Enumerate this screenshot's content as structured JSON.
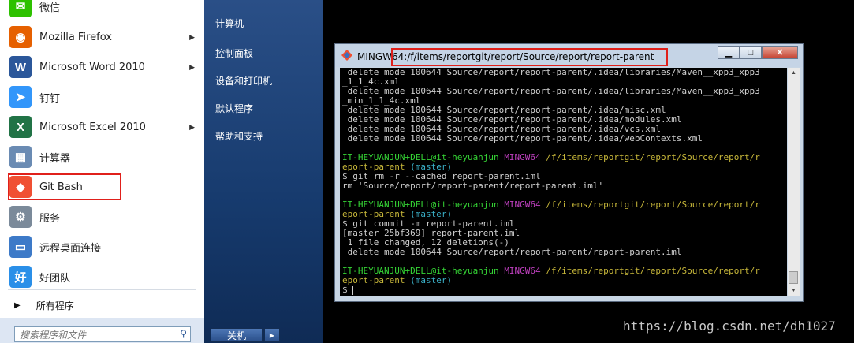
{
  "start_menu": {
    "items": [
      {
        "label": "微信",
        "icon": "wechat-icon",
        "color": "#2dc100",
        "arrow": false
      },
      {
        "label": "Mozilla Firefox",
        "icon": "firefox-icon",
        "color": "#e66000",
        "arrow": true
      },
      {
        "label": "Microsoft Word 2010",
        "icon": "word-icon",
        "color": "#2b579a",
        "arrow": true
      },
      {
        "label": "钉钉",
        "icon": "dingtalk-icon",
        "color": "#3296fa",
        "arrow": false
      },
      {
        "label": "Microsoft Excel 2010",
        "icon": "excel-icon",
        "color": "#217346",
        "arrow": true
      },
      {
        "label": "计算器",
        "icon": "calculator-icon",
        "color": "#6a8bb3",
        "arrow": false
      },
      {
        "label": "Git Bash",
        "icon": "git-bash-icon",
        "color": "#f05033",
        "arrow": false
      },
      {
        "label": "服务",
        "icon": "services-gear-icon",
        "color": "#7b8a9a",
        "arrow": false
      },
      {
        "label": "远程桌面连接",
        "icon": "remote-desktop-icon",
        "color": "#3d7ac8",
        "arrow": false
      },
      {
        "label": "好团队",
        "icon": "haotuandui-icon",
        "color": "#2a8fe8",
        "arrow": false
      }
    ],
    "all_programs": "所有程序",
    "search_placeholder": "搜索程序和文件",
    "right_items": [
      "计算机",
      "控制面板",
      "设备和打印机",
      "默认程序",
      "帮助和支持"
    ],
    "shutdown_label": "关机"
  },
  "terminal": {
    "title": "MINGW64:/f/items/reportgit/report/Source/report/report-parent",
    "lines": [
      [
        {
          "t": " delete mode 100644 Source/report/report-parent/.idea/libraries/Maven__xpp3_xpp3",
          "c": "l-white"
        }
      ],
      [
        {
          "t": "_1_1_4c.xml",
          "c": "l-white"
        }
      ],
      [
        {
          "t": " delete mode 100644 Source/report/report-parent/.idea/libraries/Maven__xpp3_xpp3",
          "c": "l-white"
        }
      ],
      [
        {
          "t": "_min_1_1_4c.xml",
          "c": "l-white"
        }
      ],
      [
        {
          "t": " delete mode 100644 Source/report/report-parent/.idea/misc.xml",
          "c": "l-white"
        }
      ],
      [
        {
          "t": " delete mode 100644 Source/report/report-parent/.idea/modules.xml",
          "c": "l-white"
        }
      ],
      [
        {
          "t": " delete mode 100644 Source/report/report-parent/.idea/vcs.xml",
          "c": "l-white"
        }
      ],
      [
        {
          "t": " delete mode 100644 Source/report/report-parent/.idea/webContexts.xml",
          "c": "l-white"
        }
      ],
      [
        {
          "t": "",
          "c": "l-white"
        }
      ],
      [
        {
          "t": "IT-HEYUANJUN+DELL@it-heyuanjun ",
          "c": "green"
        },
        {
          "t": "MINGW64 ",
          "c": "magenta"
        },
        {
          "t": "/f/items/reportgit/report/Source/report/r",
          "c": "yellow"
        }
      ],
      [
        {
          "t": "eport-parent",
          "c": "yellow"
        },
        {
          "t": " (master)",
          "c": "cyan"
        }
      ],
      [
        {
          "t": "$ git rm -r --cached report-parent.iml",
          "c": "l-white"
        }
      ],
      [
        {
          "t": "rm 'Source/report/report-parent/report-parent.iml'",
          "c": "l-white"
        }
      ],
      [
        {
          "t": "",
          "c": "l-white"
        }
      ],
      [
        {
          "t": "IT-HEYUANJUN+DELL@it-heyuanjun ",
          "c": "green"
        },
        {
          "t": "MINGW64 ",
          "c": "magenta"
        },
        {
          "t": "/f/items/reportgit/report/Source/report/r",
          "c": "yellow"
        }
      ],
      [
        {
          "t": "eport-parent",
          "c": "yellow"
        },
        {
          "t": " (master)",
          "c": "cyan"
        }
      ],
      [
        {
          "t": "$ git commit -m report-parent.iml",
          "c": "l-white"
        }
      ],
      [
        {
          "t": "[master 25bf369] report-parent.iml",
          "c": "l-white"
        }
      ],
      [
        {
          "t": " 1 file changed, 12 deletions(-)",
          "c": "l-white"
        }
      ],
      [
        {
          "t": " delete mode 100644 Source/report/report-parent/report-parent.iml",
          "c": "l-white"
        }
      ],
      [
        {
          "t": "",
          "c": "l-white"
        }
      ],
      [
        {
          "t": "IT-HEYUANJUN+DELL@it-heyuanjun ",
          "c": "green"
        },
        {
          "t": "MINGW64 ",
          "c": "magenta"
        },
        {
          "t": "/f/items/reportgit/report/Source/report/r",
          "c": "yellow"
        }
      ],
      [
        {
          "t": "eport-parent",
          "c": "yellow"
        },
        {
          "t": " (master)",
          "c": "cyan"
        }
      ],
      [
        {
          "t": "$ ",
          "c": "l-white"
        }
      ]
    ]
  },
  "watermark": "https://blog.csdn.net/dh1027"
}
